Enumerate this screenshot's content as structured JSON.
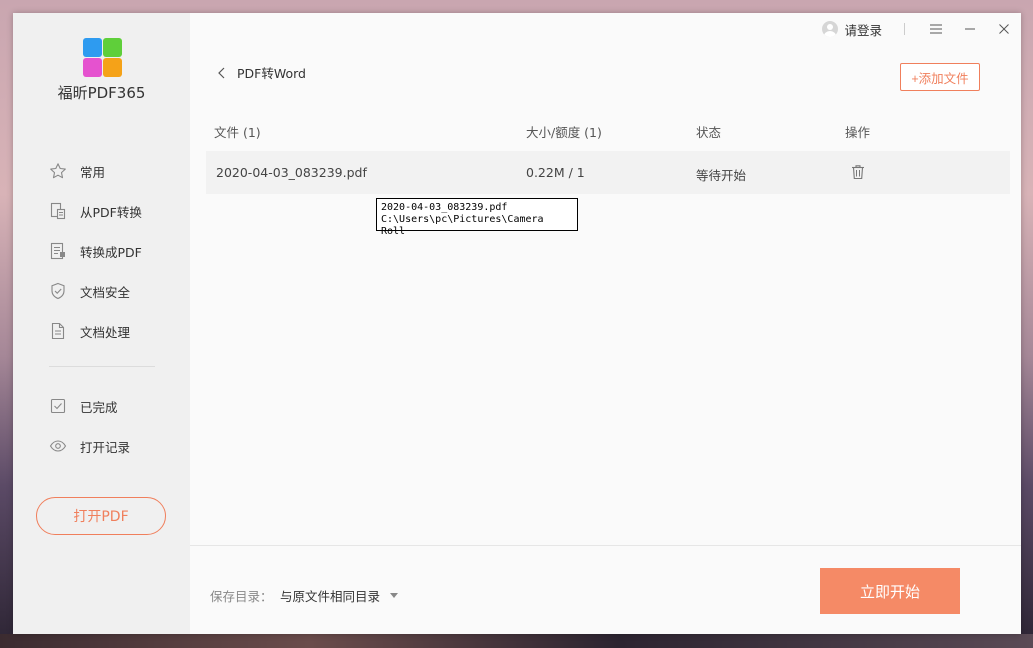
{
  "app": {
    "name": "福昕PDF365"
  },
  "titlebar": {
    "login": "请登录"
  },
  "sidebar": {
    "items": [
      {
        "label": "常用",
        "icon": "star-icon"
      },
      {
        "label": "从PDF转换",
        "icon": "convert-from-pdf-icon"
      },
      {
        "label": "转换成PDF",
        "icon": "convert-to-pdf-icon"
      },
      {
        "label": "文档安全",
        "icon": "shield-icon"
      },
      {
        "label": "文档处理",
        "icon": "document-icon"
      }
    ],
    "secondary": [
      {
        "label": "已完成",
        "icon": "checkbox-icon"
      },
      {
        "label": "打开记录",
        "icon": "eye-icon"
      }
    ],
    "open_pdf": "打开PDF"
  },
  "page": {
    "back_title": "PDF转Word",
    "add_file": "+添加文件"
  },
  "table": {
    "headers": {
      "file": "文件 (1)",
      "size": "大小/额度 (1)",
      "status": "状态",
      "action": "操作"
    },
    "rows": [
      {
        "file": "2020-04-03_083239.pdf",
        "size": "0.22M / 1",
        "status": "等待开始"
      }
    ]
  },
  "tooltip": {
    "line1": "2020-04-03_083239.pdf",
    "line2": "C:\\Users\\pc\\Pictures\\Camera Roll"
  },
  "footer": {
    "save_label": "保存目录：",
    "save_value": "与原文件相同目录",
    "start": "立即开始"
  },
  "colors": {
    "accent": "#f07f5c",
    "start_button": "#f58a66",
    "sidebar_bg": "#f0f0f0"
  }
}
